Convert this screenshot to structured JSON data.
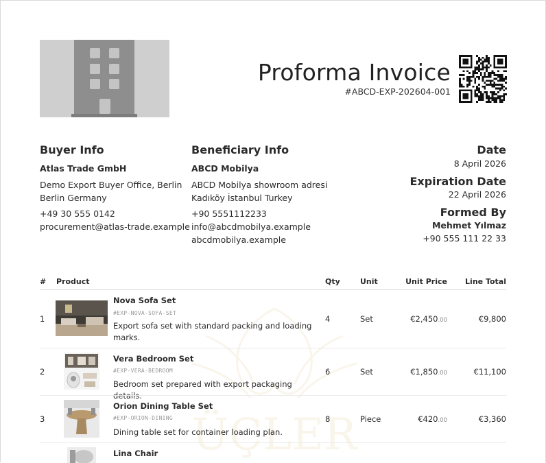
{
  "header": {
    "title": "Proforma Invoice",
    "invoice_number": "#ABCD-EXP-202604-001"
  },
  "buyer": {
    "heading": "Buyer Info",
    "name": "Atlas Trade GmbH",
    "address_line1": "Demo Export Buyer Office, Berlin",
    "address_line2": "Berlin Germany",
    "phone": "+49 30 555 0142",
    "email": "procurement@atlas-trade.example"
  },
  "beneficiary": {
    "heading": "Beneficiary Info",
    "name": "ABCD Mobilya",
    "address_line1": "ABCD Mobilya showroom adresi",
    "address_line2": "Kadıköy İstanbul Turkey",
    "phone": "+90 5551112233",
    "email": "info@abcdmobilya.example",
    "website": "abcdmobilya.example"
  },
  "meta": {
    "date_label": "Date",
    "date_value": "8 April 2026",
    "expiration_label": "Expiration Date",
    "expiration_value": "22 April 2026",
    "formed_by_label": "Formed By",
    "formed_by_name": "Mehmet Yılmaz",
    "formed_by_phone": "+90 555 111 22 33"
  },
  "table": {
    "headers": {
      "index": "#",
      "product": "Product",
      "qty": "Qty",
      "unit": "Unit",
      "unit_price": "Unit Price",
      "line_total": "Line Total"
    },
    "rows": [
      {
        "index": "1",
        "name": "Nova Sofa Set",
        "code": "#EXP-NOVA-SOFA-SET",
        "description": "Export sofa set with standard packing and loading marks.",
        "qty": "4",
        "unit": "Set",
        "unit_price": "€2,450",
        "unit_price_cents": ".00",
        "line_total": "€9,800"
      },
      {
        "index": "2",
        "name": "Vera Bedroom Set",
        "code": "#EXP-VERA-BEDROOM",
        "description": "Bedroom set prepared with export packaging details.",
        "qty": "6",
        "unit": "Set",
        "unit_price": "€1,850",
        "unit_price_cents": ".00",
        "line_total": "€11,100"
      },
      {
        "index": "3",
        "name": "Orion Dining Table Set",
        "code": "#EXP-ORION-DINING",
        "description": "Dining table set for container loading plan.",
        "qty": "8",
        "unit": "Piece",
        "unit_price": "€420",
        "unit_price_cents": ".00",
        "line_total": "€3,360"
      },
      {
        "index": "",
        "name": "Lina Chair",
        "code": "",
        "description": "",
        "qty": "",
        "unit": "",
        "unit_price": "",
        "unit_price_cents": "",
        "line_total": ""
      }
    ]
  },
  "icons": {
    "logo": "building-icon",
    "qr": "qr-code-icon"
  },
  "watermark_text": "ÜÇLER"
}
